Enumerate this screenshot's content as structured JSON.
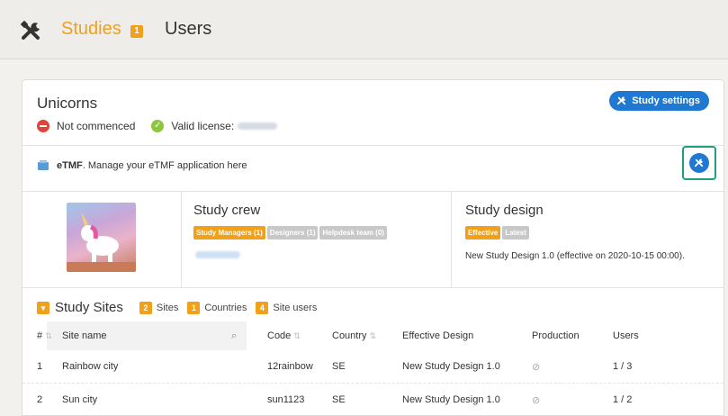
{
  "nav": {
    "studies_label": "Studies",
    "studies_badge": "1",
    "users_label": "Users"
  },
  "study": {
    "name": "Unicorns",
    "status": "Not commenced",
    "license": "Valid license:",
    "settings_label": "Study settings"
  },
  "etmf": {
    "bold": "eTMF",
    "text": ". Manage your eTMF application here"
  },
  "crew": {
    "title": "Study crew",
    "roles": [
      "Study Managers (1)",
      "Designers (1)",
      "Helpdesk team (0)"
    ]
  },
  "design": {
    "title": "Study design",
    "effective": "Effective",
    "latest": "Latest",
    "text": "New Study Design 1.0 (effective on 2020-10-15 00:00)."
  },
  "sites": {
    "title": "Study Sites",
    "sites_count": "2",
    "sites_label": "Sites",
    "countries_count": "1",
    "countries_label": "Countries",
    "users_count": "4",
    "users_label": "Site users"
  },
  "table": {
    "headers": {
      "num": "#",
      "site_name": "Site name",
      "code": "Code",
      "country": "Country",
      "effective_design": "Effective Design",
      "production": "Production",
      "users": "Users"
    },
    "rows": [
      {
        "num": "1",
        "name": "Rainbow city",
        "code": "12rainbow",
        "country": "SE",
        "design": "New Study Design 1.0",
        "users": "1 / 3"
      },
      {
        "num": "2",
        "name": "Sun city",
        "code": "sun1123",
        "country": "SE",
        "design": "New Study Design 1.0",
        "users": "1 / 2"
      }
    ]
  },
  "colors": {
    "accent": "#f0a019",
    "primary": "#1f78d1",
    "highlight_border": "#1ea07a"
  }
}
